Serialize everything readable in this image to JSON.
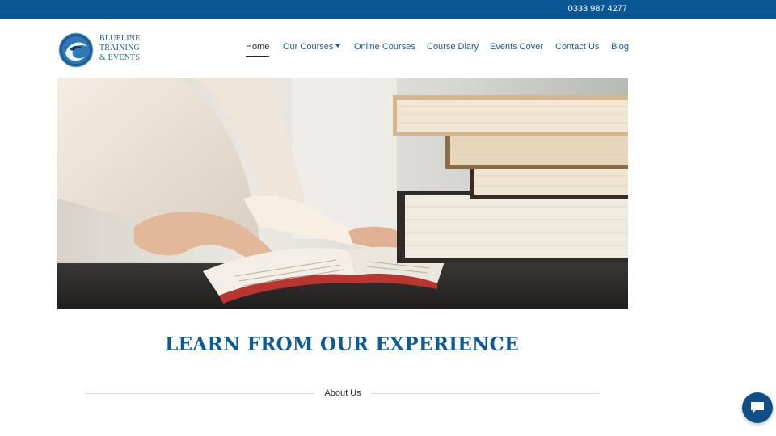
{
  "topbar": {
    "phone": "0333 987 4277"
  },
  "logo": {
    "line1": "BLUELINE",
    "line2": "TRAINING",
    "line3": "& EVENTS"
  },
  "nav": {
    "items": [
      {
        "label": "Home"
      },
      {
        "label": "Our Courses"
      },
      {
        "label": "Online Courses"
      },
      {
        "label": "Course Diary"
      },
      {
        "label": "Events Cover"
      },
      {
        "label": "Contact Us"
      },
      {
        "label": "Blog"
      }
    ],
    "active": "Home"
  },
  "hero": {
    "image": "person reading an open book beside a stack of books"
  },
  "main": {
    "headline": "LEARN FROM OUR EXPERIENCE",
    "section_label": "About Us"
  },
  "chat": {
    "icon": "chat-bubble-icon"
  },
  "colors": {
    "topbar": "#0a5796",
    "brand_blue": "#0e5a98",
    "nav_link": "#1a5c94",
    "chat_button": "#0d4f86"
  }
}
